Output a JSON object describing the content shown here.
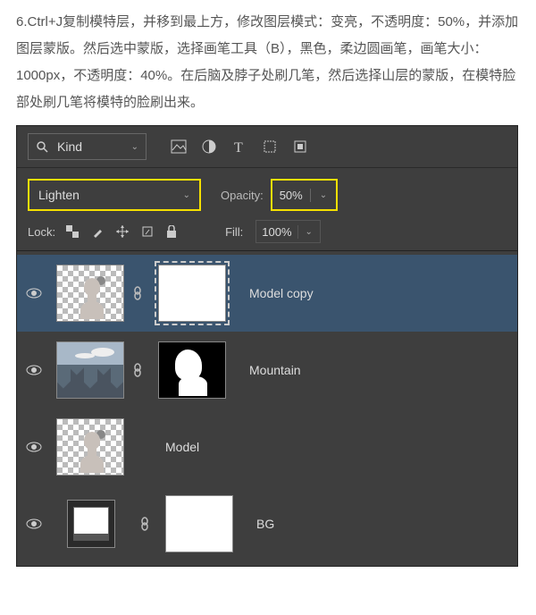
{
  "instruction": "6.Ctrl+J复制模特层，并移到最上方，修改图层模式：变亮，不透明度：50%，并添加图层蒙版。然后选中蒙版，选择画笔工具（B），黑色，柔边圆画笔，画笔大小：1000px，不透明度：40%。在后脑及脖子处刷几笔，然后选择山层的蒙版，在模特脸部处刷几笔将模特的脸刷出来。",
  "filter": {
    "label": "Kind"
  },
  "blend": {
    "mode": "Lighten",
    "opacity_label": "Opacity:",
    "opacity_value": "50%"
  },
  "lock": {
    "label": "Lock:",
    "fill_label": "Fill:",
    "fill_value": "100%"
  },
  "layers": [
    {
      "name": "Model copy",
      "selected": true,
      "has_mask": true
    },
    {
      "name": "Mountain",
      "selected": false,
      "has_mask": true
    },
    {
      "name": "Model",
      "selected": false,
      "has_mask": false
    },
    {
      "name": "BG",
      "selected": false,
      "has_mask": true
    }
  ]
}
